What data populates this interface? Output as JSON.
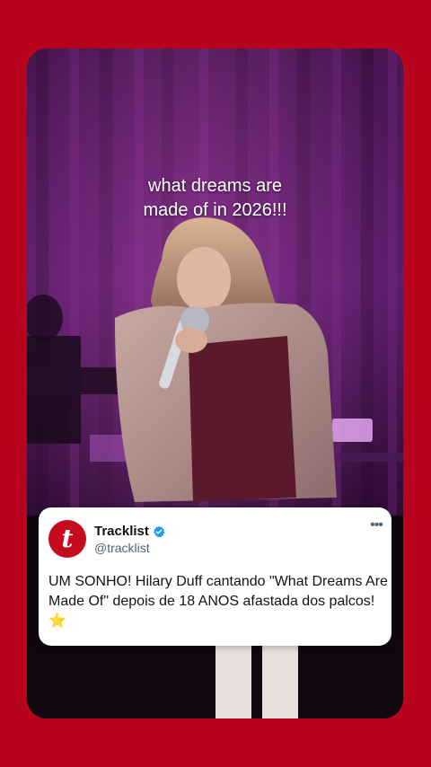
{
  "video": {
    "caption_line1": "what dreams are",
    "caption_line2": "made of in 2026!!!"
  },
  "tweet": {
    "avatar_letter": "t",
    "author_name": "Tracklist",
    "handle": "@tracklist",
    "more_label": "•••",
    "text": "UM SONHO! Hilary Duff cantando \"What Dreams Are Made Of\" depois de 18 ANOS afastada dos palcos!",
    "emoji": "⭐",
    "verified_icon": "verified-badge-icon"
  },
  "colors": {
    "background": "#b7041c",
    "avatar": "#c60a1e",
    "verified": "#1d9bf0"
  }
}
